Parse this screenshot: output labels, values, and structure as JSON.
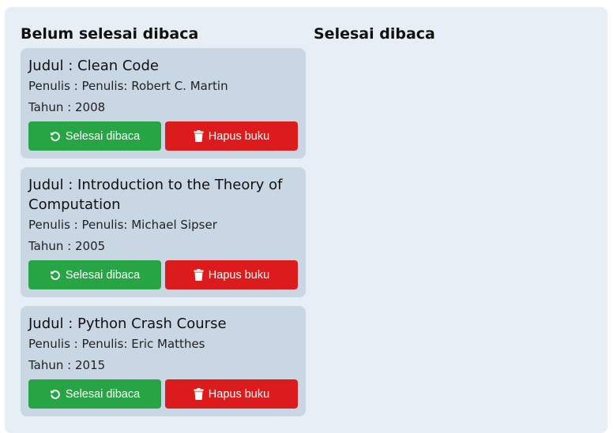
{
  "columns": {
    "unread_title": "Belum selesai dibaca",
    "read_title": "Selesai dibaca"
  },
  "books_unread": [
    {
      "title": "Judul : Clean Code",
      "author": "Penulis : Penulis: Robert C. Martin",
      "year": "Tahun : 2008",
      "done_label": "Selesai dibaca",
      "delete_label": "Hapus buku"
    },
    {
      "title": "Judul : Introduction to the Theory of Computation",
      "author": "Penulis : Penulis: Michael Sipser",
      "year": "Tahun : 2005",
      "done_label": "Selesai dibaca",
      "delete_label": "Hapus buku"
    },
    {
      "title": "Judul : Python Crash Course",
      "author": "Penulis : Penulis: Eric Matthes",
      "year": "Tahun : 2015",
      "done_label": "Selesai dibaca",
      "delete_label": "Hapus buku"
    }
  ],
  "icons": {
    "done": "undo-icon",
    "delete": "trash-icon"
  },
  "colors": {
    "done_button": "#27a444",
    "delete_button": "#dc1c1c",
    "card_bg": "#c9d6e4",
    "panel_bg": "#e8eef6"
  }
}
